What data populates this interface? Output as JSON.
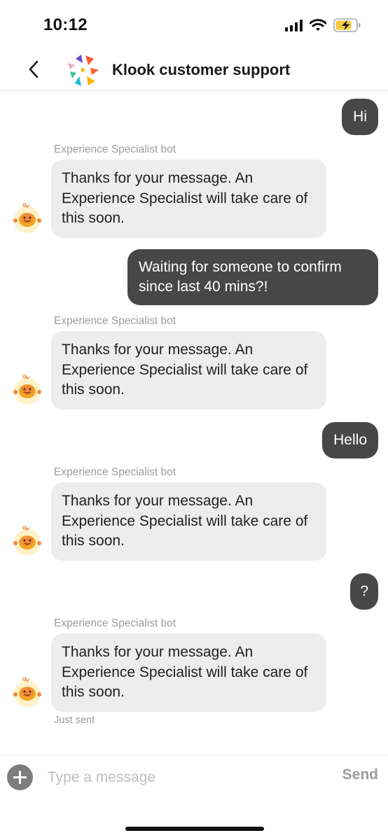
{
  "status": {
    "time": "10:12",
    "icons": [
      "signal-icon",
      "wifi-icon",
      "battery-charging-icon"
    ]
  },
  "header": {
    "title": "Klook customer support",
    "back_icon": "chevron-left-icon",
    "logo_icon": "klook-logo-icon"
  },
  "messages": [
    {
      "type": "outgoing",
      "text": "Hi"
    },
    {
      "type": "incoming",
      "sender": "Experience Specialist bot",
      "text": "Thanks for your message. An Experience Specialist will take care of this soon."
    },
    {
      "type": "outgoing",
      "text": "Waiting for someone to confirm since last 40 mins?!"
    },
    {
      "type": "incoming",
      "sender": "Experience Specialist bot",
      "text": "Thanks for your message. An Experience Specialist will take care of this soon."
    },
    {
      "type": "outgoing",
      "text": "Hello"
    },
    {
      "type": "incoming",
      "sender": "Experience Specialist bot",
      "text": "Thanks for your message. An Experience Specialist will take care of this soon."
    },
    {
      "type": "outgoing",
      "text": "?"
    },
    {
      "type": "incoming",
      "sender": "Experience Specialist bot",
      "text": "Thanks for your message. An Experience Specialist will take care of this soon.",
      "meta": "Just sent"
    }
  ],
  "input": {
    "placeholder": "Type a message",
    "value": "",
    "send_label": "Send",
    "add_icon": "plus-circle-icon"
  },
  "colors": {
    "outgoing_bubble": "#474747",
    "incoming_bubble": "#ededed",
    "secondary_text": "#9d9d9d"
  }
}
